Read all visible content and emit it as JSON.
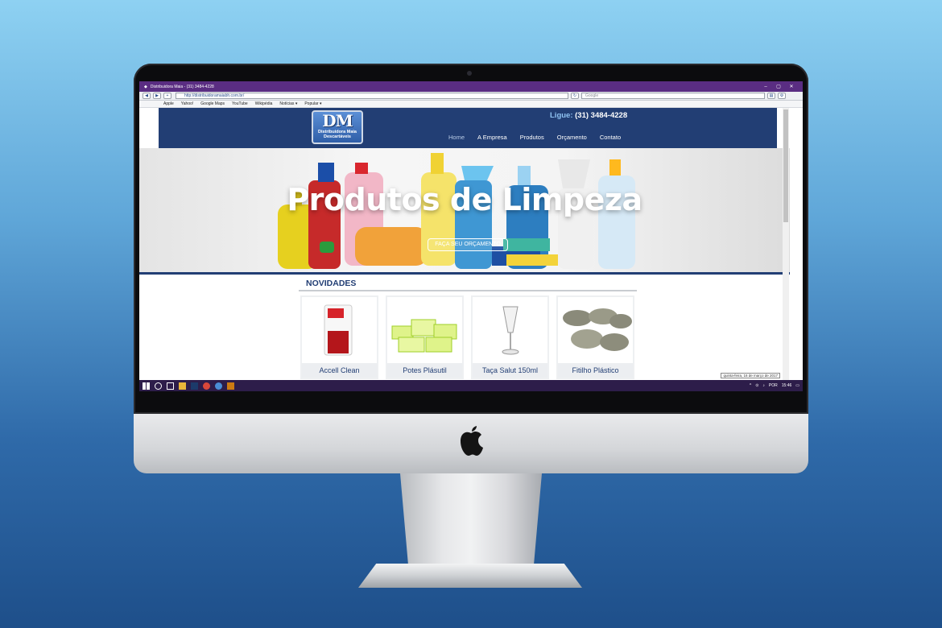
{
  "browser": {
    "window_title": "Distribuidora Maia - (31) 3484-4228",
    "url": "http://distribuidoramaiabh.com.br/",
    "search_placeholder": "Google",
    "bookmarks": [
      "Apple",
      "Yahoo!",
      "Google Maps",
      "YouTube",
      "Wikipédia",
      "Notícias ▾",
      "Popular ▾"
    ]
  },
  "site": {
    "logo_main": "DM",
    "logo_line1": "Distribuidora Maia",
    "logo_line2": "Descartáveis",
    "phone_label": "Ligue:",
    "phone_number": "(31) 3484-4228",
    "menu": [
      "Home",
      "A Empresa",
      "Produtos",
      "Orçamento",
      "Contato"
    ],
    "hero_title": "Produtos de Limpeza",
    "hero_button": "FAÇA SEU ORÇAMENTO",
    "section_title": "NOVIDADES",
    "products": [
      {
        "name": "Accell Clean"
      },
      {
        "name": "Potes Plásutil"
      },
      {
        "name": "Taça Salut 150ml"
      },
      {
        "name": "Fitilho Plástico"
      }
    ]
  },
  "taskbar": {
    "datetime_tooltip": "quinta-feira, 16 de março de 2017",
    "language": "POR",
    "time": "15:46"
  },
  "colors": {
    "brand_navy": "#223e74",
    "titlebar": "#5a2d82",
    "taskbar": "#2d1d4a"
  }
}
